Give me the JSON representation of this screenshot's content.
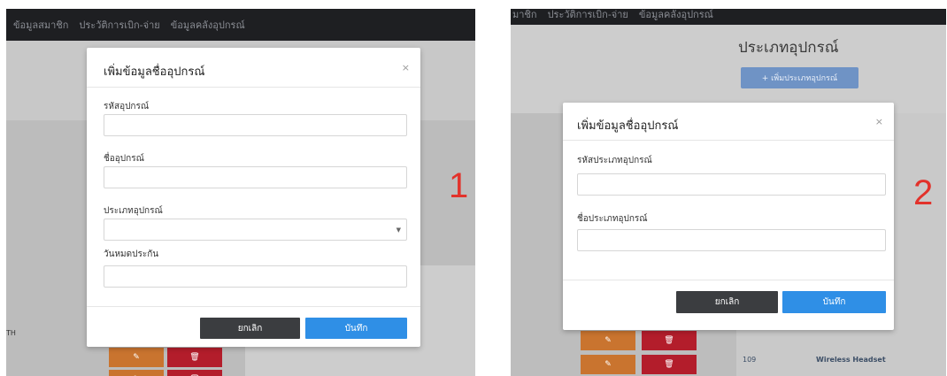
{
  "panel1": {
    "nav_items": [
      "ข้อมูลสมาชิก",
      "ประวัติการเบิก-จ่าย",
      "ข้อมูลคลังอุปกรณ์"
    ],
    "modal": {
      "title": "เพิ่มข้อมูลชื่ออุปกรณ์",
      "close": "×",
      "fields": [
        {
          "label": "รหัสอุปกรณ์",
          "value": "",
          "type": "text"
        },
        {
          "label": "ชื่ออุปกรณ์",
          "value": "",
          "type": "text"
        },
        {
          "label": "ประเภทอุปกรณ์",
          "value": "",
          "type": "select"
        },
        {
          "label": "วันหมดประกัน",
          "value": "",
          "type": "text"
        }
      ],
      "cancel_label": "ยกเลิก",
      "save_label": "บันทึก"
    },
    "step_number": "1",
    "side_texts": [
      "TH"
    ]
  },
  "panel2": {
    "nav_items": [
      "มาชิก",
      "ประวัติการเบิก-จ่าย",
      "ข้อมูลคลังอุปกรณ์"
    ],
    "bg_title": "ประเภทอุปกรณ์",
    "add_type_button": "+ เพิ่มประเภทอุปกรณ์",
    "modal": {
      "title": "เพิ่มข้อมูลชื่ออุปกรณ์",
      "close": "×",
      "fields": [
        {
          "label": "รหัสประเภทอุปกรณ์",
          "value": "",
          "type": "text"
        },
        {
          "label": "ชื่อประเภทอุปกรณ์",
          "value": "",
          "type": "text"
        }
      ],
      "cancel_label": "ยกเลิก",
      "save_label": "บันทึก"
    },
    "step_number": "2",
    "table_row": {
      "id": "109",
      "name": "Wireless Headset"
    }
  },
  "colors": {
    "navbar": "#1e1f22",
    "save": "#2f8fe6",
    "cancel": "#3b3d40",
    "edit": "#c9742f",
    "delete": "#b31d2b",
    "step_number": "#e2322b"
  }
}
